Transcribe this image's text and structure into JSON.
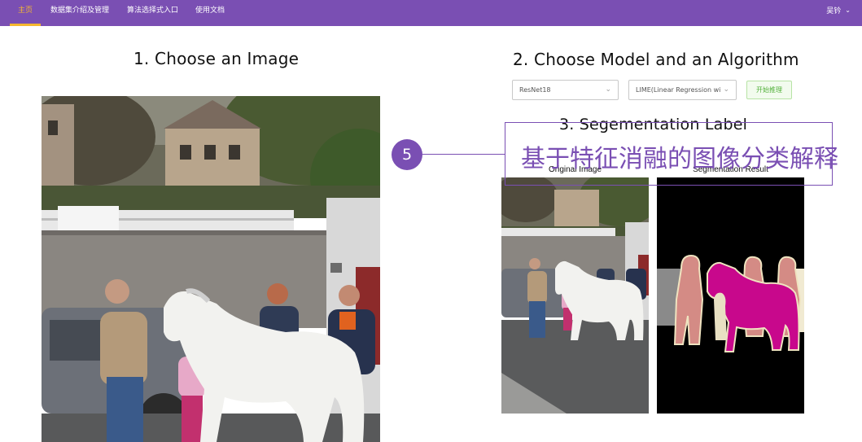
{
  "nav": {
    "items": [
      "主页",
      "数据集介绍及管理",
      "算法选择式入口",
      "使用文档"
    ],
    "user": "吴钤"
  },
  "section1": {
    "title": "1. Choose an Image"
  },
  "section2": {
    "title": "2. Choose Model and an Algorithm",
    "model_select": "ResNet18",
    "algorithm_select": "LIME(Linear Regression wi",
    "start_button": "开始推理"
  },
  "section3": {
    "title": "3. Segementation Label",
    "original_caption": "Original Image",
    "segmentation_caption": "Segmentation Result"
  },
  "annotation": {
    "number": "5",
    "text": "基于特征消融的图像分类解释",
    "color": "#7a4fb3"
  },
  "colors": {
    "nav_bg": "#7a4fb3",
    "nav_active": "#f5b730",
    "button_green": "#52b03a"
  }
}
